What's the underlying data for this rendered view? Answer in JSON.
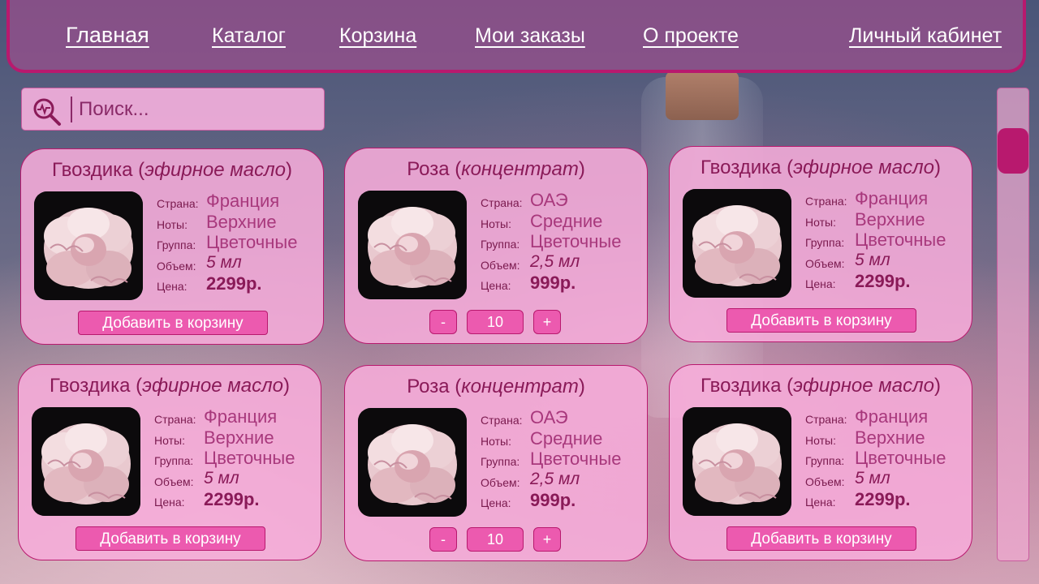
{
  "nav": {
    "items": [
      {
        "label": "Главная"
      },
      {
        "label": "Каталог"
      },
      {
        "label": "Корзина"
      },
      {
        "label": "Мои заказы"
      },
      {
        "label": "О проекте"
      },
      {
        "label": "Личный кабинет"
      }
    ]
  },
  "search": {
    "placeholder": "Поиск..."
  },
  "spec_labels": {
    "country": "Страна:",
    "notes": "Ноты:",
    "group": "Группа:",
    "volume": "Объем:",
    "price": "Цена:"
  },
  "products": [
    {
      "name": "Гвоздика (",
      "type": "эфирное масло",
      "close": ")",
      "country": "Франция",
      "notes": "Верхние",
      "group": "Цветочные",
      "volume": "5 мл",
      "price": "2299р.",
      "action": "Добавить в корзину"
    },
    {
      "name": "Роза (",
      "type": "концентрат",
      "close": ")",
      "country": "ОАЭ",
      "notes": "Средние",
      "group": "Цветочные",
      "volume": "2,5 мл",
      "price": "999р.",
      "minus": "-",
      "qty": "10",
      "plus": "+"
    },
    {
      "name": "Гвоздика (",
      "type": "эфирное масло",
      "close": ")",
      "country": "Франция",
      "notes": "Верхние",
      "group": "Цветочные",
      "volume": "5 мл",
      "price": "2299р.",
      "action": "Добавить в корзину"
    },
    {
      "name": "Гвоздика (",
      "type": "эфирное масло",
      "close": ")",
      "country": "Франция",
      "notes": "Верхние",
      "group": "Цветочные",
      "volume": "5 мл",
      "price": "2299р.",
      "action": "Добавить в корзину"
    },
    {
      "name": "Роза (",
      "type": "концентрат",
      "close": ")",
      "country": "ОАЭ",
      "notes": "Средние",
      "group": "Цветочные",
      "volume": "2,5 мл",
      "price": "999р.",
      "minus": "-",
      "qty": "10",
      "plus": "+"
    },
    {
      "name": "Гвоздика (",
      "type": "эфирное масло",
      "close": ")",
      "country": "Франция",
      "notes": "Верхние",
      "group": "Цветочные",
      "volume": "5 мл",
      "price": "2299р.",
      "action": "Добавить в корзину"
    }
  ],
  "colors": {
    "accent": "#b8196e",
    "card": "#f6acda",
    "button": "#ec5aaf",
    "text": "#8a1a58"
  },
  "icons": {
    "search": "search-magnifier-icon",
    "product_image": "carnation-flower-image"
  }
}
